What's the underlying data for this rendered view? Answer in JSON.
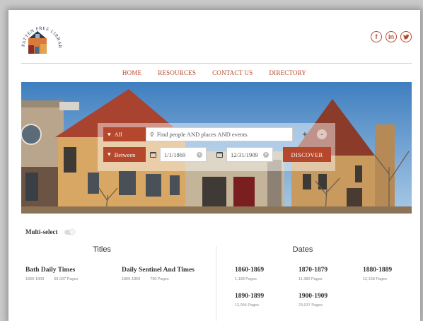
{
  "logo": {
    "ring_text": "PATTEN FREE LIBRARY"
  },
  "social": [
    {
      "label": "f",
      "icon": "facebook-icon"
    },
    {
      "label": "in",
      "icon": "linkedin-icon"
    },
    {
      "label": "✦",
      "icon": "twitter-icon"
    }
  ],
  "nav": {
    "items": [
      "HOME",
      "RESOURCES",
      "CONTACT US",
      "DIRECTORY"
    ]
  },
  "search": {
    "scope_label": "All",
    "query_placeholder": "Find people AND places AND events",
    "range_label": "Between",
    "date_from": "1/1/1869",
    "date_to": "12/31/1909",
    "plus_label": "+",
    "minus_label": "-",
    "discover_label": "DISCOVER"
  },
  "multiselect": {
    "label": "Multi-select"
  },
  "titles": {
    "heading": "Titles",
    "items": [
      {
        "name": "Bath Daily Times",
        "years": "1869-1909",
        "pages": "59,037 Pages"
      },
      {
        "name": "Daily Sentinel And Times",
        "years": "1869-1869",
        "pages": "790 Pages"
      }
    ]
  },
  "dates": {
    "heading": "Dates",
    "items": [
      {
        "range": "1860-1869",
        "pages": "1,198 Pages"
      },
      {
        "range": "1870-1879",
        "pages": "11,380 Pages"
      },
      {
        "range": "1880-1889",
        "pages": "12,158 Pages"
      },
      {
        "range": "1890-1899",
        "pages": "12,054 Pages"
      },
      {
        "range": "1900-1909",
        "pages": "23,037 Pages"
      }
    ]
  },
  "colors": {
    "accent": "#b5472c",
    "text": "#333333"
  }
}
